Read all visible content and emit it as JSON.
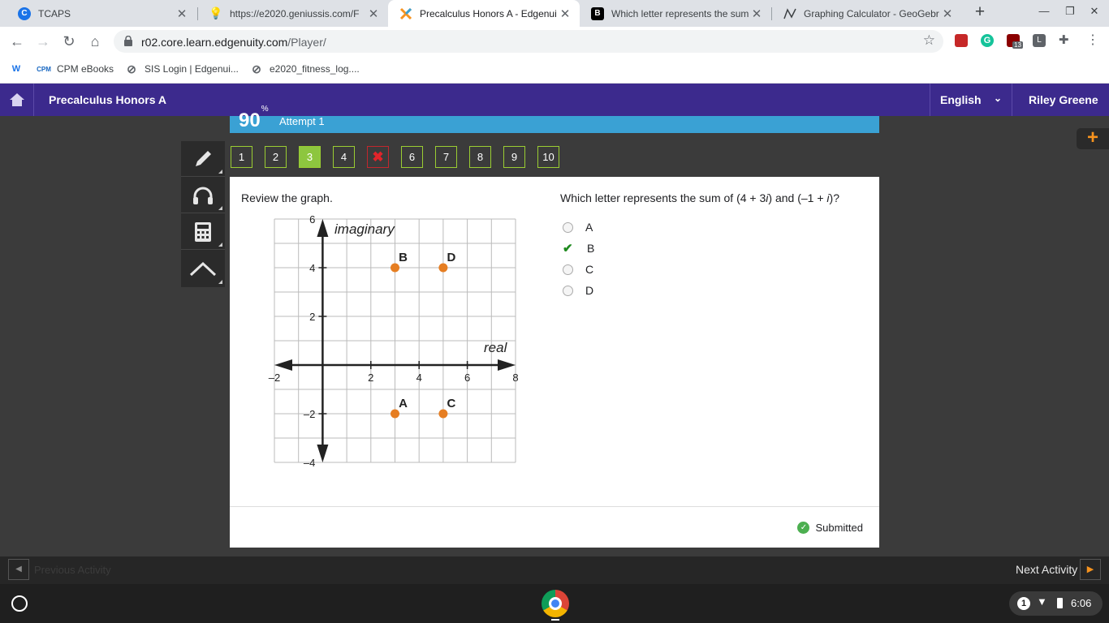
{
  "browser": {
    "tabs": [
      {
        "title": "TCAPS",
        "favicon": "tcaps-icon",
        "active": false
      },
      {
        "title": "https://e2020.geniussis.com/F",
        "favicon": "lightbulb-icon",
        "active": false
      },
      {
        "title": "Precalculus Honors A - Edgenuity",
        "favicon": "edgenuity-icon",
        "active": true
      },
      {
        "title": "Which letter represents the sum",
        "favicon": "brainly-icon",
        "active": false
      },
      {
        "title": "Graphing Calculator - GeoGebra",
        "favicon": "geogebra-icon",
        "active": false
      }
    ],
    "url_host": "r02.core.learn.edgenuity.com",
    "url_path": "/Player/",
    "extension_badge": "13",
    "bookmarks": [
      {
        "label": "",
        "icon": "w-icon"
      },
      {
        "label": "CPM eBooks",
        "icon": "cpm-icon"
      },
      {
        "label": "SIS Login | Edgenui...",
        "icon": "globe-icon"
      },
      {
        "label": "e2020_fitness_log....",
        "icon": "globe-icon"
      }
    ]
  },
  "app": {
    "course_title": "Precalculus Honors A",
    "language": "English",
    "user_name": "Riley Greene",
    "score": "90",
    "score_unit": "%",
    "attempt": "Attempt 1",
    "question_numbers": [
      "1",
      "2",
      "3",
      "4",
      "",
      "6",
      "7",
      "8",
      "9",
      "10"
    ],
    "current_question": "3",
    "wrong_question": "5",
    "tools": [
      "pencil-icon",
      "headphones-icon",
      "calculator-icon",
      "arch-icon"
    ],
    "review_label": "Review the graph.",
    "question_text_parts": [
      "Which letter represents the sum of (4 + 3",
      "i",
      ") and (–1 + ",
      "i",
      ")?"
    ],
    "options": [
      "A",
      "B",
      "C",
      "D"
    ],
    "selected_option": "B",
    "status": "Submitted",
    "prev_label": "Previous Activity",
    "next_label": "Next Activity",
    "accent_colors": {
      "header": "#3c2a8d",
      "score_bar": "#3aa1d4",
      "current_question": "#8dc63f",
      "point": "#e67e22"
    }
  },
  "chart_data": {
    "type": "scatter",
    "xlabel": "real",
    "ylabel": "imaginary",
    "xlim": [
      -2,
      8
    ],
    "ylim": [
      -4,
      6
    ],
    "x_ticks": [
      "–2",
      "2",
      "4",
      "6",
      "8"
    ],
    "y_ticks": [
      "6",
      "4",
      "2",
      "–2",
      "–4"
    ],
    "grid": true,
    "points": [
      {
        "label": "B",
        "x": 3,
        "y": 4
      },
      {
        "label": "D",
        "x": 5,
        "y": 4
      },
      {
        "label": "A",
        "x": 3,
        "y": -2
      },
      {
        "label": "C",
        "x": 5,
        "y": -2
      }
    ]
  },
  "shelf": {
    "notification_count": "1",
    "time": "6:06"
  }
}
